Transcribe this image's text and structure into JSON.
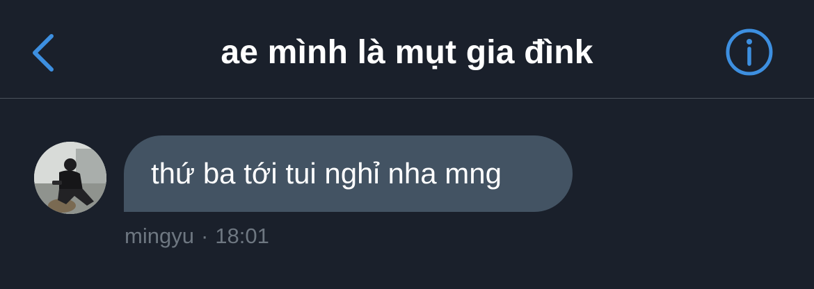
{
  "header": {
    "title": "ae mình là mụt gia đìnk",
    "back_icon": "chevron-left-icon",
    "info_icon": "info-circle-icon"
  },
  "message": {
    "text": "thứ ba tới tui nghỉ nha mng",
    "sender": "mingyu",
    "separator": "·",
    "time": "18:01"
  },
  "colors": {
    "background": "#1a202b",
    "accent": "#3d8fe0",
    "bubble": "#435363",
    "meta_text": "#6e7781",
    "divider": "#4b525c"
  }
}
